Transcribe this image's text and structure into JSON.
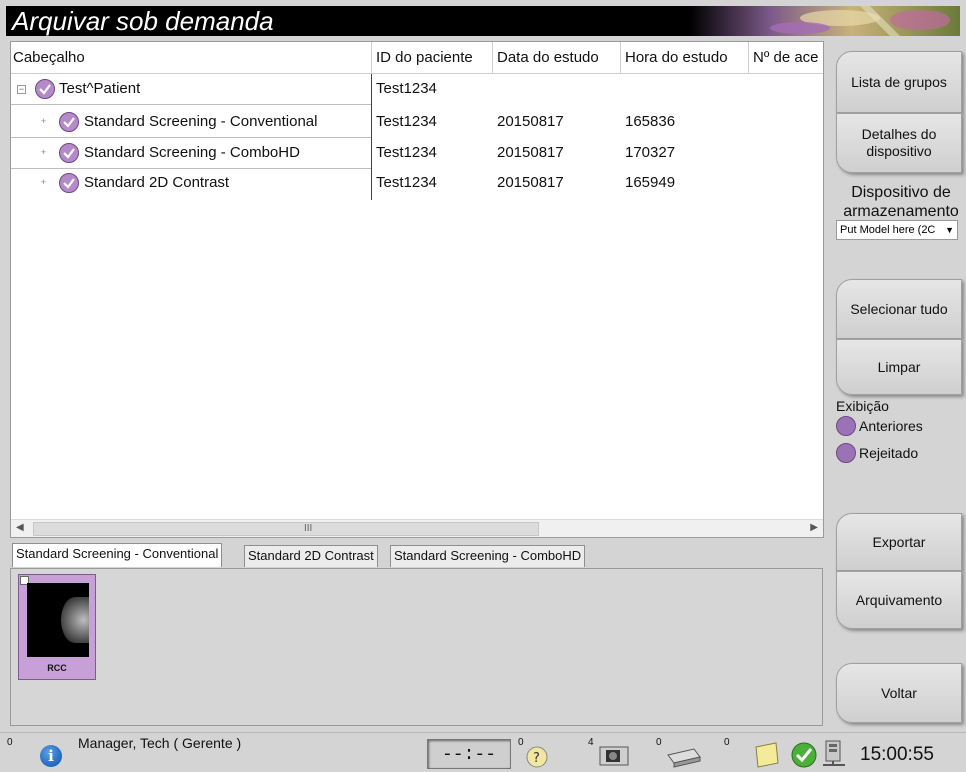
{
  "window": {
    "title": "Arquivar sob demanda"
  },
  "grid": {
    "columns": [
      "Cabeçalho",
      "ID do paciente",
      "Data do estudo",
      "Hora do estudo",
      "Nº de ace"
    ],
    "rows": [
      {
        "name": "Test^Patient",
        "patient_id": "Test1234",
        "date": "",
        "time": ""
      },
      {
        "name": "Standard Screening - Conventional",
        "patient_id": "Test1234",
        "date": "20150817",
        "time": "165836"
      },
      {
        "name": "Standard Screening - ComboHD",
        "patient_id": "Test1234",
        "date": "20150817",
        "time": "170327"
      },
      {
        "name": "Standard 2D Contrast",
        "patient_id": "Test1234",
        "date": "20150817",
        "time": "165949"
      }
    ],
    "scroll_grip": "III"
  },
  "tabs": [
    "Standard Screening - Conventional",
    "Standard 2D Contrast",
    "Standard Screening - ComboHD"
  ],
  "thumbnail": {
    "label": "RCC"
  },
  "sidebar": {
    "group_list": "Lista de grupos",
    "device_details": "Detalhes do dispositivo",
    "storage_label": "Dispositivo de armazenamento",
    "storage_value": "Put Model here (2C",
    "select_all": "Selecionar tudo",
    "clear": "Limpar",
    "display_label": "Exibição",
    "previous": "Anteriores",
    "rejected": "Rejeitado",
    "export": "Exportar",
    "archive": "Arquivamento",
    "back": "Voltar"
  },
  "status": {
    "info_count": "0",
    "user": "Manager, Tech ( Gerente )",
    "clock_placeholder": "--:--",
    "count_a": "0",
    "count_b": "4",
    "count_c": "0",
    "count_d": "0",
    "time": "15:00:55"
  },
  "colors": {
    "accent_purple": "#b48bc8",
    "title_bg": "#000000"
  }
}
